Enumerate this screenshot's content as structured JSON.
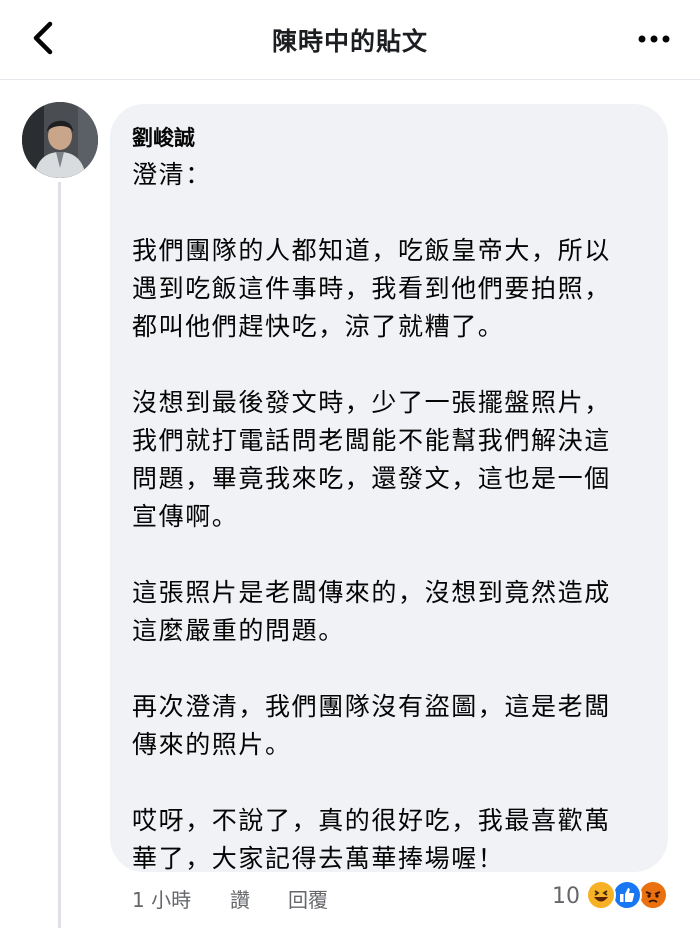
{
  "header": {
    "title": "陳時中的貼文",
    "back_icon": "chevron-left-icon",
    "more_icon": "more-horizontal-icon"
  },
  "comment": {
    "author": "劉峻誠",
    "paragraphs": [
      "澄清：",
      "我們團隊的人都知道，吃飯皇帝大，所以\n遇到吃飯這件事時，我看到他們要拍照，\n都叫他們趕快吃，涼了就糟了。",
      "沒想到最後發文時，少了一張擺盤照片，\n我們就打電話問老闆能不能幫我們解決這\n問題，畢竟我來吃，還發文，這也是一個\n宣傳啊。",
      "這張照片是老闆傳來的，沒想到竟然造成\n這麼嚴重的問題。",
      "再次澄清，我們團隊沒有盜圖，這是老闆\n傳來的照片。",
      "哎呀，不說了，真的很好吃，我最喜歡萬\n華了，大家記得去萬華捧場喔！"
    ],
    "time": "1 小時",
    "like_label": "讚",
    "reply_label": "回覆",
    "reaction_count": "10",
    "reactions": [
      "haha-icon",
      "like-icon",
      "angry-icon"
    ]
  },
  "colors": {
    "bubble_bg": "#f0f2f5",
    "like_blue": "#1877f2",
    "haha_yellow": "#f7b125",
    "angry_orange": "#e9710f",
    "meta_gray": "#65676b"
  }
}
